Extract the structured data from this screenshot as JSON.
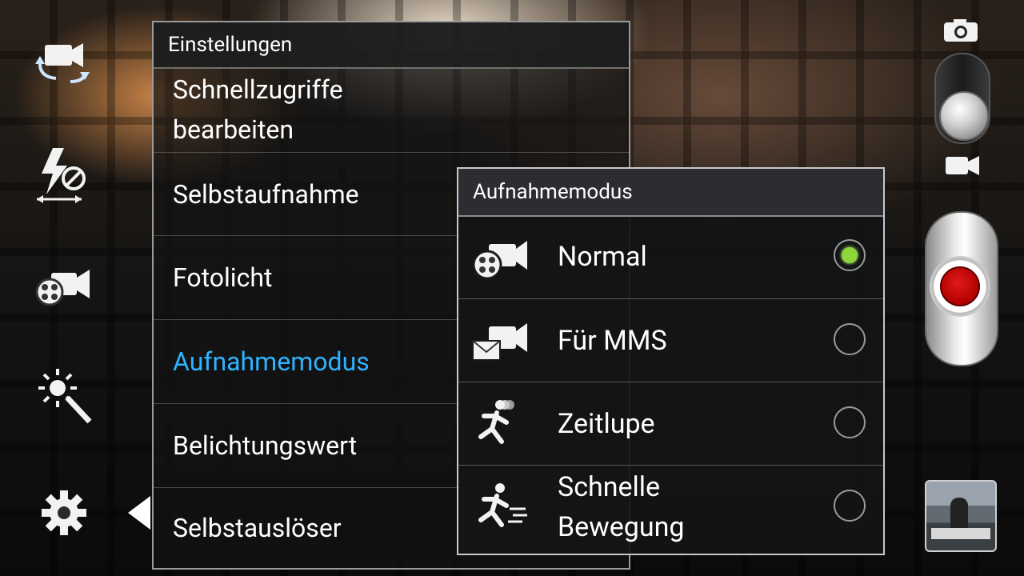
{
  "settings": {
    "title": "Einstellungen",
    "items": [
      {
        "label_lines": [
          "Schnellzugriffe",
          "bearbeiten"
        ]
      },
      {
        "label": "Selbstaufnahme"
      },
      {
        "label": "Fotolicht"
      },
      {
        "label": "Aufnahmemodus",
        "active": true
      },
      {
        "label": "Belichtungswert"
      },
      {
        "label": "Selbstauslöser"
      }
    ]
  },
  "popup": {
    "title": "Aufnahmemodus",
    "options": [
      {
        "label": "Normal",
        "icon": "video-normal-icon",
        "selected": true
      },
      {
        "label": "Für MMS",
        "icon": "video-mms-icon",
        "selected": false
      },
      {
        "label": "Zeitlupe",
        "icon": "slow-motion-icon",
        "selected": false
      },
      {
        "label_lines": [
          "Schnelle",
          "Bewegung"
        ],
        "icon": "fast-motion-icon",
        "selected": false
      }
    ],
    "radio_selected_color": "#8ed63a"
  },
  "left_controls": [
    "switch-camera-icon",
    "flash-off-icon",
    "recording-mode-icon",
    "effects-icon",
    "settings-gear-icon"
  ],
  "right_controls": [
    "camera-icon",
    "mode-switch",
    "video-icon",
    "record-button",
    "gallery-thumbnail"
  ],
  "colors": {
    "active_text": "#2eb3ff",
    "record_red": "#d00000"
  }
}
